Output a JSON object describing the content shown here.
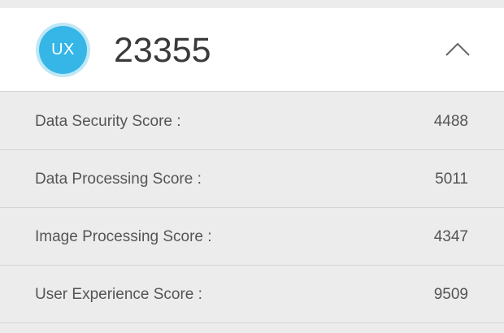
{
  "header": {
    "badge_text": "UX",
    "total_score": "23355",
    "collapse_icon": "chevron-up-icon"
  },
  "rows": [
    {
      "label": "Data Security Score :",
      "value": "4488"
    },
    {
      "label": "Data Processing Score :",
      "value": "5011"
    },
    {
      "label": "Image Processing Score :",
      "value": "4347"
    },
    {
      "label": "User Experience Score :",
      "value": "9509"
    }
  ],
  "colors": {
    "accent": "#35b6e6",
    "accent_ring": "#bfe7f5",
    "header_bg": "#ffffff",
    "row_bg": "#ececec"
  }
}
